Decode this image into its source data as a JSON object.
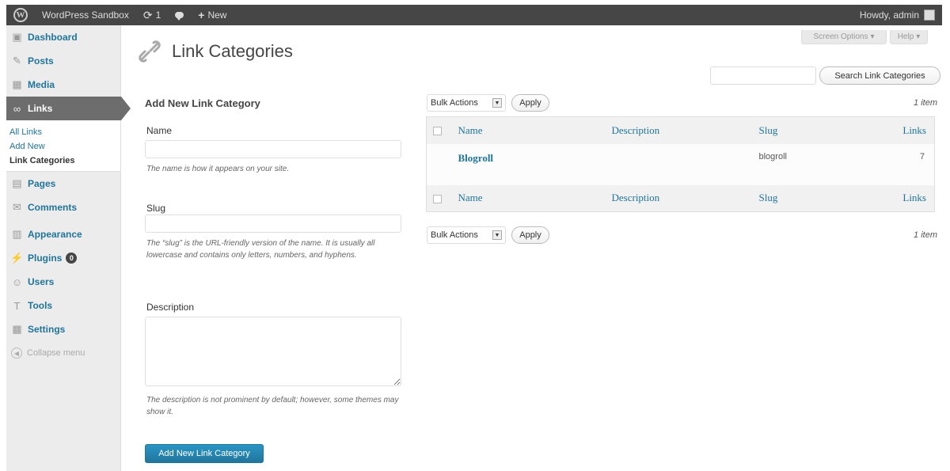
{
  "adminbar": {
    "site_name": "WordPress Sandbox",
    "updates_count": "1",
    "new_label": "New",
    "greeting": "Howdy, admin"
  },
  "sidebar": {
    "items": [
      {
        "label": "Dashboard",
        "icon": "dashboard-icon"
      },
      {
        "label": "Posts",
        "icon": "pin-icon"
      },
      {
        "label": "Media",
        "icon": "media-icon"
      },
      {
        "label": "Links",
        "icon": "link-icon"
      },
      {
        "label": "Pages",
        "icon": "page-icon"
      },
      {
        "label": "Comments",
        "icon": "comment-icon"
      },
      {
        "label": "Appearance",
        "icon": "appearance-icon"
      },
      {
        "label": "Plugins",
        "icon": "plugin-icon",
        "badge": "0"
      },
      {
        "label": "Users",
        "icon": "users-icon"
      },
      {
        "label": "Tools",
        "icon": "tools-icon"
      },
      {
        "label": "Settings",
        "icon": "settings-icon"
      }
    ],
    "links_submenu": [
      "All Links",
      "Add New",
      "Link Categories"
    ],
    "collapse_label": "Collapse menu"
  },
  "header": {
    "title": "Link Categories",
    "screen_options": "Screen Options",
    "help": "Help"
  },
  "search": {
    "button_label": "Search Link Categories",
    "value": ""
  },
  "form": {
    "heading": "Add New Link Category",
    "name_label": "Name",
    "name_value": "",
    "name_hint": "The name is how it appears on your site.",
    "slug_label": "Slug",
    "slug_value": "",
    "slug_hint": "The “slug” is the URL-friendly version of the name. It is usually all lowercase and contains only letters, numbers, and hyphens.",
    "description_label": "Description",
    "description_value": "",
    "description_hint": "The description is not prominent by default; however, some themes may show it.",
    "submit_label": "Add New Link Category"
  },
  "table": {
    "bulk_actions": "Bulk Actions",
    "apply": "Apply",
    "items_count": "1 item",
    "columns": [
      "Name",
      "Description",
      "Slug",
      "Links"
    ],
    "rows": [
      {
        "name": "Blogroll",
        "description": "",
        "slug": "blogroll",
        "links": "7"
      }
    ]
  },
  "colors": {
    "adminbar_bg": "#464646",
    "link_blue": "#21759b",
    "current_menu_bg": "#6d6d6d",
    "primary_button": "#21759b"
  }
}
